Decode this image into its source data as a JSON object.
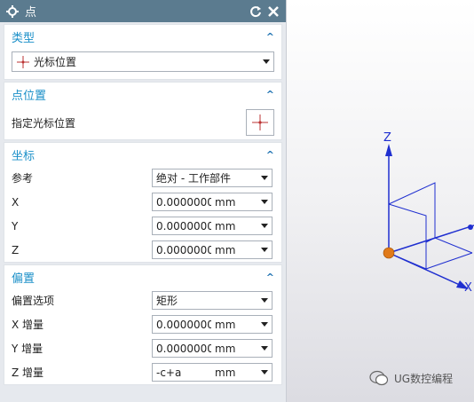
{
  "dialog": {
    "title": "点",
    "reset_icon": "reset-icon",
    "close_icon": "close-icon"
  },
  "type_section": {
    "header": "类型",
    "selected": "光标位置"
  },
  "point_location": {
    "header": "点位置",
    "label": "指定光标位置"
  },
  "coordinates": {
    "header": "坐标",
    "reference_label": "参考",
    "reference_value": "绝对 - 工作部件",
    "rows": [
      {
        "label": "X",
        "value": "0.000000000(",
        "unit": "mm"
      },
      {
        "label": "Y",
        "value": "0.000000000(",
        "unit": "mm"
      },
      {
        "label": "Z",
        "value": "0.000000000(",
        "unit": "mm"
      }
    ]
  },
  "offset": {
    "header": "偏置",
    "option_label": "偏置选项",
    "option_value": "矩形",
    "rows": [
      {
        "label": "X 增量",
        "value": "0.000000000(",
        "unit": "mm"
      },
      {
        "label": "Y 增量",
        "value": "0.000000000(",
        "unit": "mm"
      },
      {
        "label": "Z 增量",
        "value": "-c+a",
        "unit": "mm"
      }
    ]
  },
  "viewport": {
    "z_axis": "Z",
    "x_axis": "X",
    "axis_color": "#1f2fd0",
    "origin_color": "#e07a1a"
  },
  "watermark": "UG数控编程"
}
